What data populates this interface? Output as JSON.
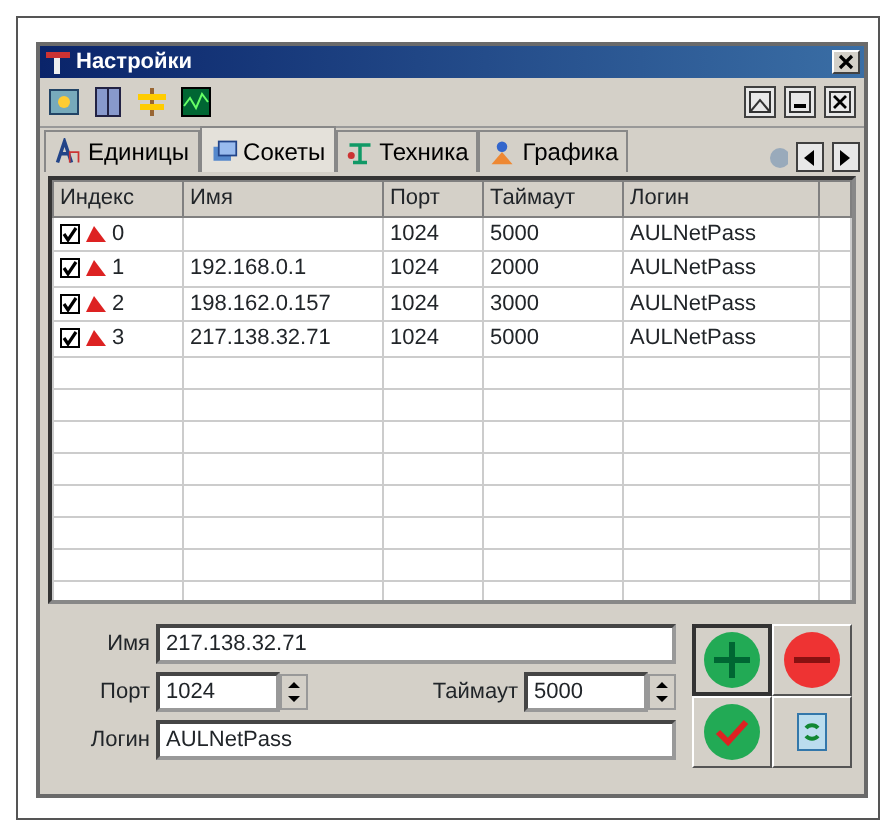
{
  "window": {
    "title": "Настройки"
  },
  "tabs": [
    {
      "label": "Единицы",
      "selected": false
    },
    {
      "label": "Сокеты",
      "selected": true
    },
    {
      "label": "Техника",
      "selected": false
    },
    {
      "label": "Графика",
      "selected": false
    }
  ],
  "table": {
    "columns": [
      "Индекс",
      "Имя",
      "Порт",
      "Таймаут",
      "Логин"
    ],
    "rows": [
      {
        "checked": true,
        "index": "0",
        "name": "",
        "port": "1024",
        "timeout": "5000",
        "login": "AULNetPass"
      },
      {
        "checked": true,
        "index": "1",
        "name": "192.168.0.1",
        "port": "1024",
        "timeout": "2000",
        "login": "AULNetPass"
      },
      {
        "checked": true,
        "index": "2",
        "name": "198.162.0.157",
        "port": "1024",
        "timeout": "3000",
        "login": "AULNetPass"
      },
      {
        "checked": true,
        "index": "3",
        "name": "217.138.32.71",
        "port": "1024",
        "timeout": "5000",
        "login": "AULNetPass"
      }
    ]
  },
  "form": {
    "name_label": "Имя",
    "name_value": "217.138.32.71",
    "port_label": "Порт",
    "port_value": "1024",
    "timeout_label": "Таймаут",
    "timeout_value": "5000",
    "login_label": "Логин",
    "login_value": "AULNetPass"
  }
}
